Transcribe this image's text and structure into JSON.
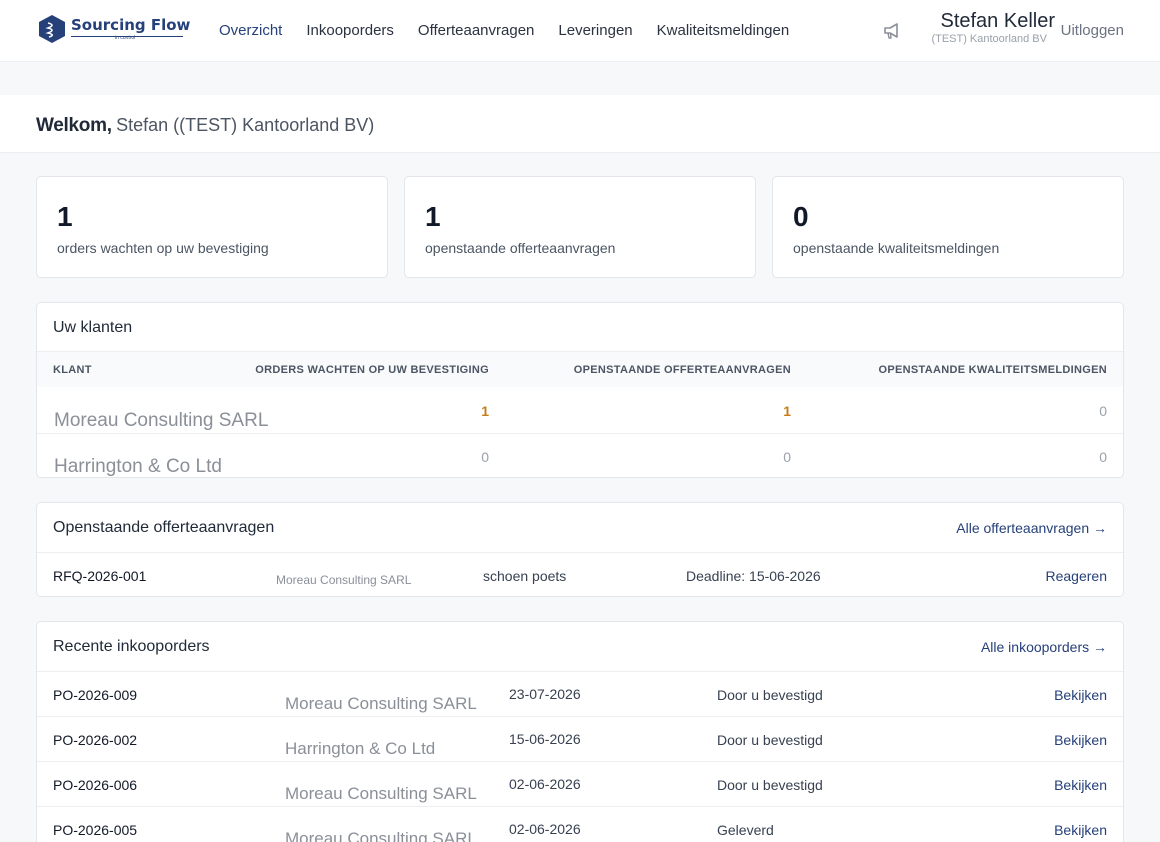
{
  "header": {
    "logo_text": "Sourcing Flow",
    "logo_sub": "in control",
    "nav": [
      {
        "label": "Overzicht",
        "active": true
      },
      {
        "label": "Inkooporders"
      },
      {
        "label": "Offerteaanvragen"
      },
      {
        "label": "Leveringen"
      },
      {
        "label": "Kwaliteitsmeldingen"
      }
    ],
    "user_name": "Stefan Keller",
    "user_org": "(TEST) Kantoorland BV",
    "logout_label": "Uitloggen",
    "icons": {
      "logo": "hexagon-logo-icon",
      "announcements": "megaphone-icon"
    }
  },
  "welcome": {
    "label": "Welkom,",
    "user": "Stefan ((TEST) Kantoorland BV)"
  },
  "stats": [
    {
      "value": "1",
      "label": "orders wachten op uw bevestiging"
    },
    {
      "value": "1",
      "label": "openstaande offerteaanvragen"
    },
    {
      "value": "0",
      "label": "openstaande kwaliteitsmeldingen"
    }
  ],
  "clients": {
    "title": "Uw klanten",
    "columns": [
      "KLANT",
      "ORDERS WACHTEN OP UW BEVESTIGING",
      "OPENSTAANDE OFFERTEAANVRAGEN",
      "OPENSTAANDE KWALITEITSMELDINGEN"
    ],
    "rows": [
      {
        "name": "Moreau Consulting SARL",
        "orders": "1",
        "rfqs": "1",
        "quality": "0"
      },
      {
        "name": "Harrington & Co Ltd",
        "orders": "0",
        "rfqs": "0",
        "quality": "0"
      }
    ],
    "highlight_color": "#c77d17"
  },
  "rfqs": {
    "title": "Openstaande offerteaanvragen",
    "link": "Alle offerteaanvragen →",
    "rows": [
      {
        "id": "RFQ-2026-001",
        "client": "Moreau Consulting SARL",
        "subject": "schoen poets",
        "deadline": "Deadline: 15-06-2026",
        "action": "Reageren"
      }
    ]
  },
  "orders": {
    "title": "Recente inkooporders",
    "link": "Alle inkooporders →",
    "rows": [
      {
        "id": "PO-2026-009",
        "client": "Moreau Consulting SARL",
        "date": "23-07-2026",
        "status": "Door u bevestigd",
        "action": "Bekijken"
      },
      {
        "id": "PO-2026-002",
        "client": "Harrington & Co Ltd",
        "date": "15-06-2026",
        "status": "Door u bevestigd",
        "action": "Bekijken"
      },
      {
        "id": "PO-2026-006",
        "client": "Moreau Consulting SARL",
        "date": "02-06-2026",
        "status": "Door u bevestigd",
        "action": "Bekijken"
      },
      {
        "id": "PO-2026-005",
        "client": "Moreau Consulting SARL",
        "date": "02-06-2026",
        "status": "Geleverd",
        "action": "Bekijken"
      }
    ]
  },
  "colors": {
    "brand": "#26407a",
    "background": "#f7f8fa",
    "card": "#ffffff"
  }
}
